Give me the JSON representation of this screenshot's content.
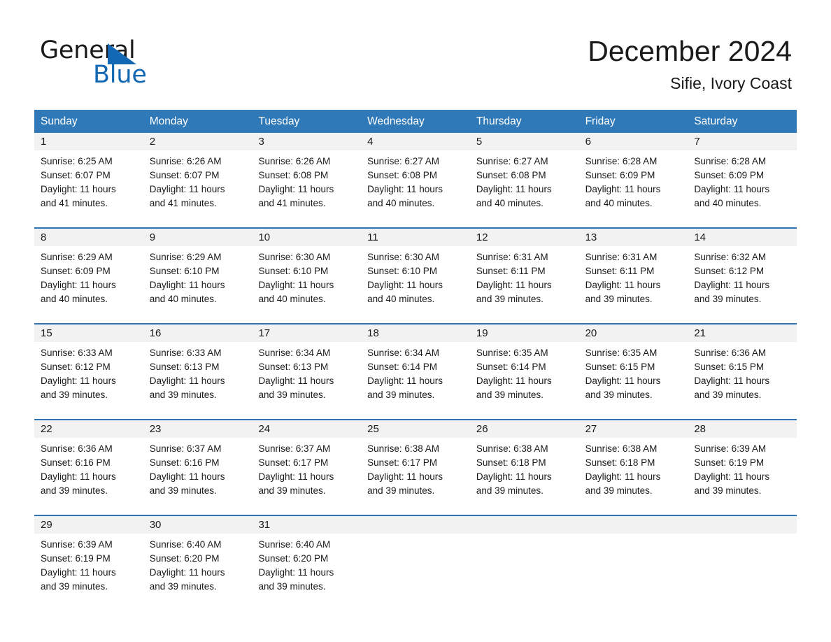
{
  "logo": {
    "line1": "General",
    "line2": "Blue",
    "flag_icon": "triangle-flag-icon",
    "accent_color": "#1268b3"
  },
  "header": {
    "title": "December 2024",
    "subtitle": "Sifie, Ivory Coast"
  },
  "theme": {
    "header_row_bg": "#3079b8",
    "row_divider": "#2e74b5",
    "day_number_bg": "#f2f2f2"
  },
  "weekdays": [
    "Sunday",
    "Monday",
    "Tuesday",
    "Wednesday",
    "Thursday",
    "Friday",
    "Saturday"
  ],
  "weeks": [
    [
      {
        "day": "1",
        "sunrise": "Sunrise: 6:25 AM",
        "sunset": "Sunset: 6:07 PM",
        "daylight_line1": "Daylight: 11 hours",
        "daylight_line2": "and 41 minutes."
      },
      {
        "day": "2",
        "sunrise": "Sunrise: 6:26 AM",
        "sunset": "Sunset: 6:07 PM",
        "daylight_line1": "Daylight: 11 hours",
        "daylight_line2": "and 41 minutes."
      },
      {
        "day": "3",
        "sunrise": "Sunrise: 6:26 AM",
        "sunset": "Sunset: 6:08 PM",
        "daylight_line1": "Daylight: 11 hours",
        "daylight_line2": "and 41 minutes."
      },
      {
        "day": "4",
        "sunrise": "Sunrise: 6:27 AM",
        "sunset": "Sunset: 6:08 PM",
        "daylight_line1": "Daylight: 11 hours",
        "daylight_line2": "and 40 minutes."
      },
      {
        "day": "5",
        "sunrise": "Sunrise: 6:27 AM",
        "sunset": "Sunset: 6:08 PM",
        "daylight_line1": "Daylight: 11 hours",
        "daylight_line2": "and 40 minutes."
      },
      {
        "day": "6",
        "sunrise": "Sunrise: 6:28 AM",
        "sunset": "Sunset: 6:09 PM",
        "daylight_line1": "Daylight: 11 hours",
        "daylight_line2": "and 40 minutes."
      },
      {
        "day": "7",
        "sunrise": "Sunrise: 6:28 AM",
        "sunset": "Sunset: 6:09 PM",
        "daylight_line1": "Daylight: 11 hours",
        "daylight_line2": "and 40 minutes."
      }
    ],
    [
      {
        "day": "8",
        "sunrise": "Sunrise: 6:29 AM",
        "sunset": "Sunset: 6:09 PM",
        "daylight_line1": "Daylight: 11 hours",
        "daylight_line2": "and 40 minutes."
      },
      {
        "day": "9",
        "sunrise": "Sunrise: 6:29 AM",
        "sunset": "Sunset: 6:10 PM",
        "daylight_line1": "Daylight: 11 hours",
        "daylight_line2": "and 40 minutes."
      },
      {
        "day": "10",
        "sunrise": "Sunrise: 6:30 AM",
        "sunset": "Sunset: 6:10 PM",
        "daylight_line1": "Daylight: 11 hours",
        "daylight_line2": "and 40 minutes."
      },
      {
        "day": "11",
        "sunrise": "Sunrise: 6:30 AM",
        "sunset": "Sunset: 6:10 PM",
        "daylight_line1": "Daylight: 11 hours",
        "daylight_line2": "and 40 minutes."
      },
      {
        "day": "12",
        "sunrise": "Sunrise: 6:31 AM",
        "sunset": "Sunset: 6:11 PM",
        "daylight_line1": "Daylight: 11 hours",
        "daylight_line2": "and 39 minutes."
      },
      {
        "day": "13",
        "sunrise": "Sunrise: 6:31 AM",
        "sunset": "Sunset: 6:11 PM",
        "daylight_line1": "Daylight: 11 hours",
        "daylight_line2": "and 39 minutes."
      },
      {
        "day": "14",
        "sunrise": "Sunrise: 6:32 AM",
        "sunset": "Sunset: 6:12 PM",
        "daylight_line1": "Daylight: 11 hours",
        "daylight_line2": "and 39 minutes."
      }
    ],
    [
      {
        "day": "15",
        "sunrise": "Sunrise: 6:33 AM",
        "sunset": "Sunset: 6:12 PM",
        "daylight_line1": "Daylight: 11 hours",
        "daylight_line2": "and 39 minutes."
      },
      {
        "day": "16",
        "sunrise": "Sunrise: 6:33 AM",
        "sunset": "Sunset: 6:13 PM",
        "daylight_line1": "Daylight: 11 hours",
        "daylight_line2": "and 39 minutes."
      },
      {
        "day": "17",
        "sunrise": "Sunrise: 6:34 AM",
        "sunset": "Sunset: 6:13 PM",
        "daylight_line1": "Daylight: 11 hours",
        "daylight_line2": "and 39 minutes."
      },
      {
        "day": "18",
        "sunrise": "Sunrise: 6:34 AM",
        "sunset": "Sunset: 6:14 PM",
        "daylight_line1": "Daylight: 11 hours",
        "daylight_line2": "and 39 minutes."
      },
      {
        "day": "19",
        "sunrise": "Sunrise: 6:35 AM",
        "sunset": "Sunset: 6:14 PM",
        "daylight_line1": "Daylight: 11 hours",
        "daylight_line2": "and 39 minutes."
      },
      {
        "day": "20",
        "sunrise": "Sunrise: 6:35 AM",
        "sunset": "Sunset: 6:15 PM",
        "daylight_line1": "Daylight: 11 hours",
        "daylight_line2": "and 39 minutes."
      },
      {
        "day": "21",
        "sunrise": "Sunrise: 6:36 AM",
        "sunset": "Sunset: 6:15 PM",
        "daylight_line1": "Daylight: 11 hours",
        "daylight_line2": "and 39 minutes."
      }
    ],
    [
      {
        "day": "22",
        "sunrise": "Sunrise: 6:36 AM",
        "sunset": "Sunset: 6:16 PM",
        "daylight_line1": "Daylight: 11 hours",
        "daylight_line2": "and 39 minutes."
      },
      {
        "day": "23",
        "sunrise": "Sunrise: 6:37 AM",
        "sunset": "Sunset: 6:16 PM",
        "daylight_line1": "Daylight: 11 hours",
        "daylight_line2": "and 39 minutes."
      },
      {
        "day": "24",
        "sunrise": "Sunrise: 6:37 AM",
        "sunset": "Sunset: 6:17 PM",
        "daylight_line1": "Daylight: 11 hours",
        "daylight_line2": "and 39 minutes."
      },
      {
        "day": "25",
        "sunrise": "Sunrise: 6:38 AM",
        "sunset": "Sunset: 6:17 PM",
        "daylight_line1": "Daylight: 11 hours",
        "daylight_line2": "and 39 minutes."
      },
      {
        "day": "26",
        "sunrise": "Sunrise: 6:38 AM",
        "sunset": "Sunset: 6:18 PM",
        "daylight_line1": "Daylight: 11 hours",
        "daylight_line2": "and 39 minutes."
      },
      {
        "day": "27",
        "sunrise": "Sunrise: 6:38 AM",
        "sunset": "Sunset: 6:18 PM",
        "daylight_line1": "Daylight: 11 hours",
        "daylight_line2": "and 39 minutes."
      },
      {
        "day": "28",
        "sunrise": "Sunrise: 6:39 AM",
        "sunset": "Sunset: 6:19 PM",
        "daylight_line1": "Daylight: 11 hours",
        "daylight_line2": "and 39 minutes."
      }
    ],
    [
      {
        "day": "29",
        "sunrise": "Sunrise: 6:39 AM",
        "sunset": "Sunset: 6:19 PM",
        "daylight_line1": "Daylight: 11 hours",
        "daylight_line2": "and 39 minutes."
      },
      {
        "day": "30",
        "sunrise": "Sunrise: 6:40 AM",
        "sunset": "Sunset: 6:20 PM",
        "daylight_line1": "Daylight: 11 hours",
        "daylight_line2": "and 39 minutes."
      },
      {
        "day": "31",
        "sunrise": "Sunrise: 6:40 AM",
        "sunset": "Sunset: 6:20 PM",
        "daylight_line1": "Daylight: 11 hours",
        "daylight_line2": "and 39 minutes."
      },
      {
        "day": "",
        "sunrise": "",
        "sunset": "",
        "daylight_line1": "",
        "daylight_line2": ""
      },
      {
        "day": "",
        "sunrise": "",
        "sunset": "",
        "daylight_line1": "",
        "daylight_line2": ""
      },
      {
        "day": "",
        "sunrise": "",
        "sunset": "",
        "daylight_line1": "",
        "daylight_line2": ""
      },
      {
        "day": "",
        "sunrise": "",
        "sunset": "",
        "daylight_line1": "",
        "daylight_line2": ""
      }
    ]
  ]
}
